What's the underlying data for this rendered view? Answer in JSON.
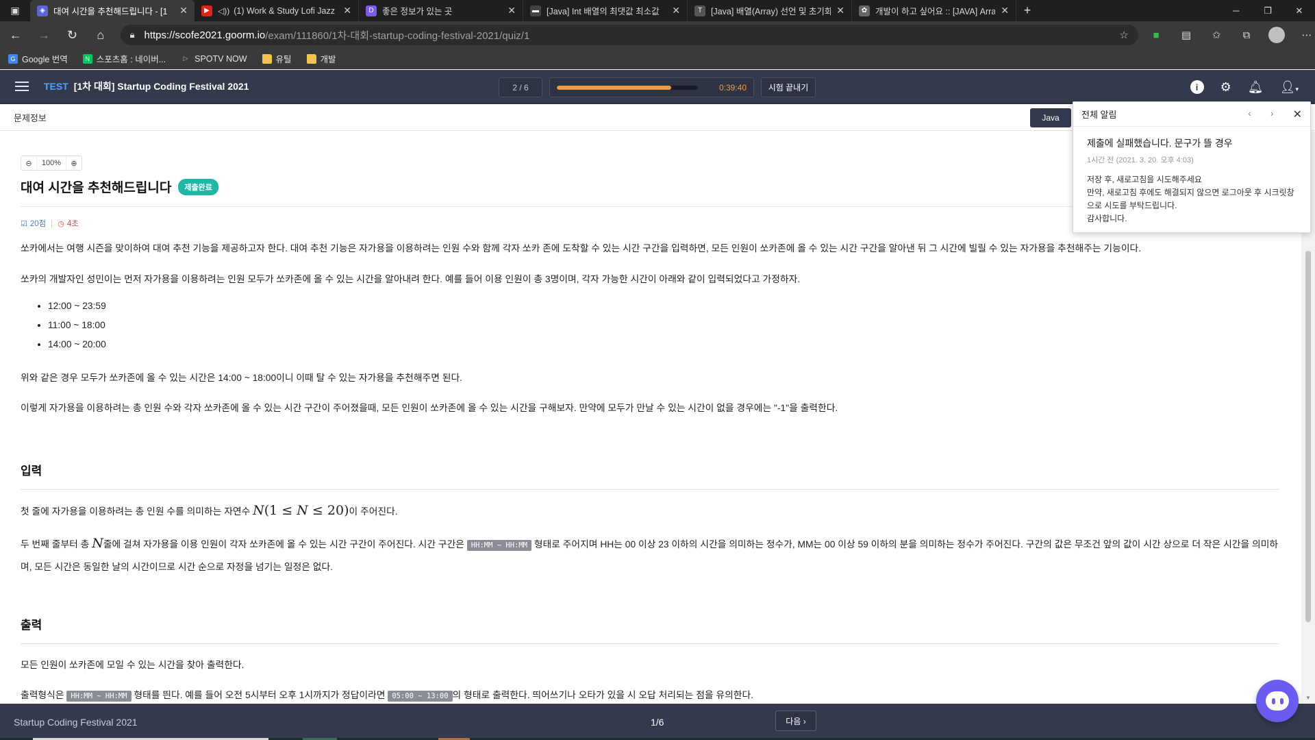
{
  "browser": {
    "tabs": [
      {
        "title": "대여 시간을 추천해드립니다 - [1",
        "fav": "goorm",
        "active": true
      },
      {
        "title": "(1) Work & Study Lofi Jazz",
        "fav": "youtube",
        "active": false
      },
      {
        "title": "좋은 정보가 있는 곳",
        "fav": "d",
        "active": false
      },
      {
        "title": "[Java] Int 배열의 최댓값 최소값",
        "fav": "blog",
        "active": false
      },
      {
        "title": "[Java] 배열(Array) 선언 및 초기화",
        "fav": "blog",
        "active": false
      },
      {
        "title": "개발이 하고 싶어요 :: [JAVA] Arra",
        "fav": "blog",
        "active": false
      }
    ],
    "url_host": "https://scofe2021.goorm.io",
    "url_path": "/exam/111860/1차-대회-startup-coding-festival-2021/quiz/1",
    "bookmarks": [
      "Google 번역",
      "스포츠홈 : 네이버...",
      "SPOTV NOW",
      "유틸",
      "개발"
    ]
  },
  "header": {
    "test_tag": "TEST",
    "exam_title": "[1차 대회] Startup Coding Festival 2021",
    "progress": "2 / 6",
    "timer": "0:39:40",
    "timer_fraction": 0.81,
    "end_button": "시험 끝내기"
  },
  "subheader": {
    "label": "문제정보",
    "language": "Java"
  },
  "problem": {
    "zoom": "100%",
    "title": "대여 시간을 추천해드립니다",
    "status_badge": "제출완료",
    "score": "20점",
    "time_limit": "4초",
    "p1": "쏘카에서는 여행 시즌을 맞이하여 대여 추천 기능을 제공하고자 한다. 대여 추천 기능은 자가용을 이용하려는 인원 수와 함께 각자 쏘카 존에 도착할 수 있는 시간 구간을 입력하면, 모든 인원이 쏘카존에 올 수 있는 시간 구간을 알아낸 뒤 그 시간에 빌릴 수 있는 자가용을 추천해주는 기능이다.",
    "p2": "쏘카의 개발자인 성민이는 먼저 자가용을 이용하려는 인원 모두가 쏘카존에 올 수 있는 시간을 알아내려 한다. 예를 들어 이용 인원이 총 3명이며, 각자 가능한 시간이 아래와 같이 입력되었다고 가정하자.",
    "times": [
      "12:00 ~ 23:59",
      "11:00 ~ 18:00",
      "14:00 ~ 20:00"
    ],
    "p3": "위와 같은 경우 모두가 쏘카존에 올 수 있는 시간은 14:00 ~ 18:00이니 이때 탈 수 있는 자가용을 추천해주면 된다.",
    "p4": "이렇게 자가용을 이용하려는 총 인원 수와 각자 쏘카존에 올 수 있는 시간 구간이 주어졌을때, 모든 인원이 쏘카존에 올 수 있는 시간을 구해보자. 만약에 모두가 만날 수 있는 시간이 없을 경우에는 \"-1\"을 출력한다.",
    "input_heading": "입력",
    "p5_pre": "첫 줄에 자가용을 이용하려는 총 인원 수를 의미하는 자연수 ",
    "p5_post": "이 주어진다.",
    "p6_a": "두 번째 줄부터 총 ",
    "p6_b": "줄에 걸쳐 자가용을 이용 인원이 각자 쏘카존에 올 수 있는 시간 구간이 주어진다. 시간 구간은 ",
    "p6_code": "HH:MM ~ HH:MM",
    "p6_c": " 형태로 주어지며 HH는 00 이상 23 이하의 시간을 의미하는 정수가, MM는 00 이상 59 이하의 분을 의미하는 정수가 주어진다. 구간의 값은 무조건 앞의 값이 시간 상으로 더 작은 시간을 의미하며, 모든 시간은 동일한 날의 시간이므로 시간 순으로 자정을 넘기는 일정은 없다.",
    "output_heading": "출력",
    "p7": "모든 인원이 쏘카존에 모일 수 있는 시간을 찾아 출력한다.",
    "p8_a": "출력형식은 ",
    "p8_code1": "HH:MM ~ HH:MM",
    "p8_b": " 형태를 띈다. 예를 들어 오전 5시부터 오후 1시까지가 정답이라면 ",
    "p8_code2": "05:00 ~ 13:00",
    "p8_c": "의 형태로 출력한다. 띄어쓰기나 오타가 있을 시 오답 처리되는 점을 유의한다."
  },
  "notification": {
    "header": "전체 알림",
    "title": "제출에 실패했습니다. 문구가 뜰 경우",
    "time": "1시간 전 (2021. 3. 20. 오후 4:03)",
    "line1": "저장 후, 새로고침을 시도해주세요",
    "line2": "만약, 새로고침 후에도 해결되지 않으면 로그아웃 후 시크릿창으로 시도를 부탁드립니다.",
    "line3": "감사합니다."
  },
  "footer": {
    "title": "Startup Coding Festival 2021",
    "page": "1/6",
    "next": "다음 ›"
  },
  "icons": [
    "tab-actions-icon",
    "youtube-icon",
    "speaker-icon",
    "back-icon",
    "forward-icon",
    "refresh-icon",
    "home-icon",
    "lock-icon",
    "star-icon",
    "menu-icon",
    "info-icon",
    "gear-icon",
    "bell-icon",
    "user-icon",
    "zoom-out-icon",
    "zoom-in-icon",
    "check-icon",
    "clock-icon",
    "chat-icon"
  ],
  "colors": {
    "accent": "#4ea3ff",
    "timer": "#f19a45",
    "badge": "#1fb8a6",
    "header": "#343a4d",
    "chat": "#6a5cf0"
  }
}
